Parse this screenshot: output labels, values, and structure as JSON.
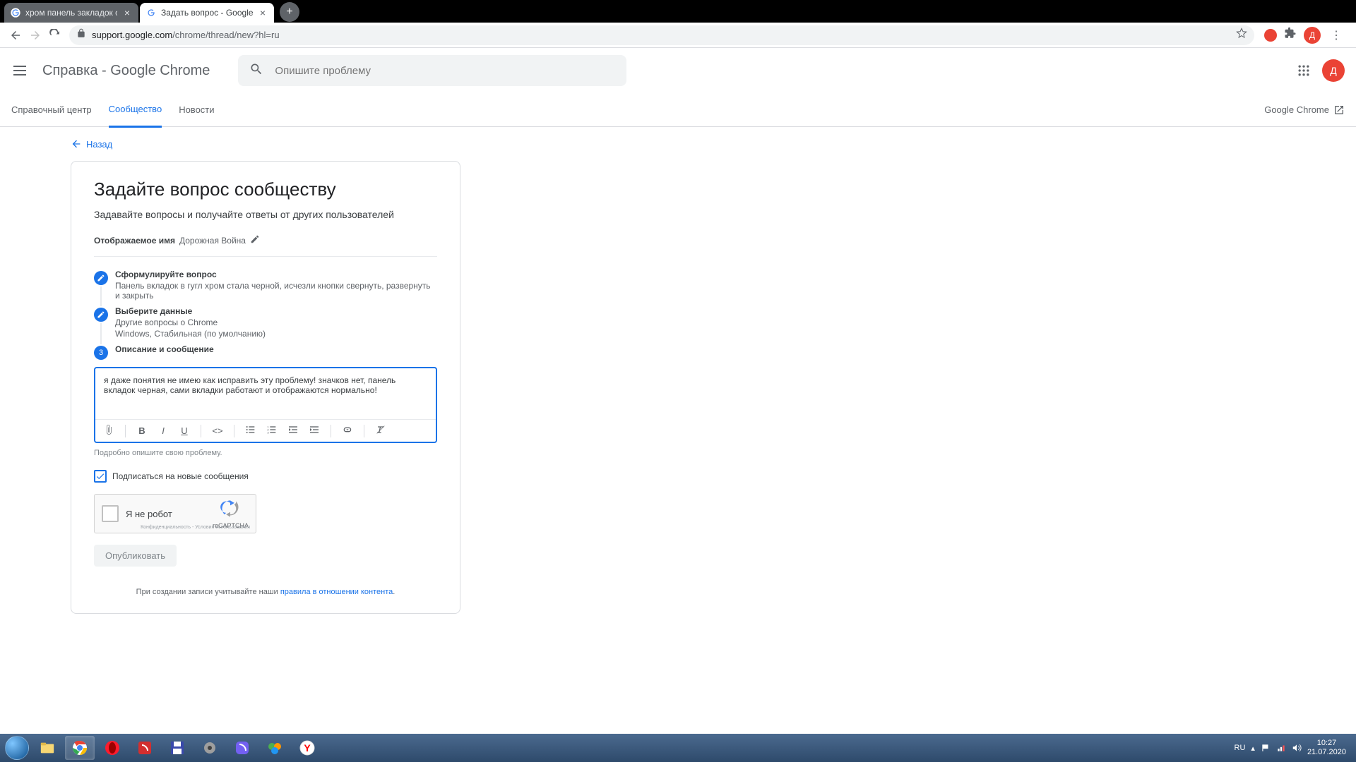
{
  "browser": {
    "tabs": [
      {
        "title": "хром панель закладок стала че",
        "active": false
      },
      {
        "title": "Задать вопрос - Google Chrome",
        "active": true
      }
    ],
    "url_host": "support.google.com",
    "url_path": "/chrome/thread/new?hl=ru",
    "avatar_letter": "Д"
  },
  "header": {
    "title": "Справка - Google Chrome",
    "search_placeholder": "Опишите проблему"
  },
  "nav": {
    "help_center": "Справочный центр",
    "community": "Сообщество",
    "news": "Новости",
    "product": "Google Chrome"
  },
  "back_link": "Назад",
  "page": {
    "heading": "Задайте вопрос сообществу",
    "subtitle": "Задавайте вопросы и получайте ответы от других пользователей",
    "display_name_label": "Отображаемое имя",
    "display_name_value": "Дорожная Война",
    "steps": {
      "s1_title": "Сформулируйте вопрос",
      "s1_sub": "Панель вкладок в гугл хром стала черной, исчезли кнопки свернуть, развернуть и закрыть",
      "s2_title": "Выберите данные",
      "s2_sub1": "Другие вопросы о Chrome",
      "s2_sub2": "Windows, Стабильная (по умолчанию)",
      "s3_title": "Описание и сообщение",
      "s3_num": "3"
    },
    "editor_text": "я даже понятия не имею как исправить эту проблему! значков нет, панель вкладок черная, сами вкладки работают и отображаются нормально!",
    "editor_hint": "Подробно опишите свою проблему.",
    "subscribe_label": "Подписаться на новые сообщения",
    "recaptcha_label": "Я не робот",
    "recaptcha_brand": "reCAPTCHA",
    "recaptcha_privacy": "Конфиденциальность - Условия использования",
    "publish_label": "Опубликовать",
    "footer_prefix": "При создании записи учитывайте наши ",
    "footer_link": "правила в отношении контента"
  },
  "taskbar": {
    "lang": "RU",
    "time": "10:27",
    "date": "21.07.2020"
  }
}
